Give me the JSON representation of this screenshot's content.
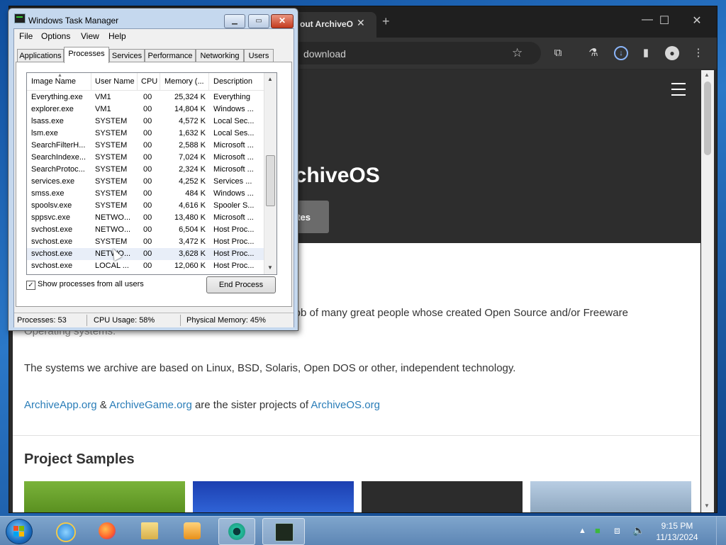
{
  "browser": {
    "tab_title": "out ArchiveO",
    "tab_close": "✕",
    "new_tab": "+",
    "url": "download",
    "minimize": "—",
    "maximize": "☐",
    "close": "✕",
    "page": {
      "hero_title": "rchiveOS",
      "hero_button": "ates",
      "intro_text": "t job of many great people whose created Open Source and/or Freeware",
      "intro_text_cont": "Operating systems.",
      "systems_text": "The systems we archive are based on Linux, BSD, Solaris, Open DOS or other, independent technology.",
      "sister_link_1": "ArchiveApp.org",
      "sister_amp": " & ",
      "sister_link_2": "ArchiveGame.org",
      "sister_mid": " are the sister projects of ",
      "sister_link_3": "ArchiveOS.org",
      "samples_title": "Project Samples"
    }
  },
  "task_manager": {
    "title": "Windows Task Manager",
    "menu": [
      "File",
      "Options",
      "View",
      "Help"
    ],
    "tabs": [
      "Applications",
      "Processes",
      "Services",
      "Performance",
      "Networking",
      "Users"
    ],
    "active_tab": "Processes",
    "columns": [
      "Image Name",
      "User Name",
      "CPU",
      "Memory (...",
      "Description"
    ],
    "processes": [
      {
        "name": "Everything.exe",
        "user": "VM1",
        "cpu": "00",
        "mem": "25,324 K",
        "desc": "Everything"
      },
      {
        "name": "explorer.exe",
        "user": "VM1",
        "cpu": "00",
        "mem": "14,804 K",
        "desc": "Windows ..."
      },
      {
        "name": "lsass.exe",
        "user": "SYSTEM",
        "cpu": "00",
        "mem": "4,572 K",
        "desc": "Local Sec..."
      },
      {
        "name": "lsm.exe",
        "user": "SYSTEM",
        "cpu": "00",
        "mem": "1,632 K",
        "desc": "Local Ses..."
      },
      {
        "name": "SearchFilterH...",
        "user": "SYSTEM",
        "cpu": "00",
        "mem": "2,588 K",
        "desc": "Microsoft ..."
      },
      {
        "name": "SearchIndexe...",
        "user": "SYSTEM",
        "cpu": "00",
        "mem": "7,024 K",
        "desc": "Microsoft ..."
      },
      {
        "name": "SearchProtoc...",
        "user": "SYSTEM",
        "cpu": "00",
        "mem": "2,324 K",
        "desc": "Microsoft ..."
      },
      {
        "name": "services.exe",
        "user": "SYSTEM",
        "cpu": "00",
        "mem": "4,252 K",
        "desc": "Services ..."
      },
      {
        "name": "smss.exe",
        "user": "SYSTEM",
        "cpu": "00",
        "mem": "484 K",
        "desc": "Windows ..."
      },
      {
        "name": "spoolsv.exe",
        "user": "SYSTEM",
        "cpu": "00",
        "mem": "4,616 K",
        "desc": "Spooler S..."
      },
      {
        "name": "sppsvc.exe",
        "user": "NETWO...",
        "cpu": "00",
        "mem": "13,480 K",
        "desc": "Microsoft ..."
      },
      {
        "name": "svchost.exe",
        "user": "NETWO...",
        "cpu": "00",
        "mem": "6,504 K",
        "desc": "Host Proc..."
      },
      {
        "name": "svchost.exe",
        "user": "SYSTEM",
        "cpu": "00",
        "mem": "3,472 K",
        "desc": "Host Proc..."
      },
      {
        "name": "svchost.exe",
        "user": "NETWO...",
        "cpu": "00",
        "mem": "3,628 K",
        "desc": "Host Proc..."
      },
      {
        "name": "svchost.exe",
        "user": "LOCAL ...",
        "cpu": "00",
        "mem": "12,060 K",
        "desc": "Host Proc..."
      }
    ],
    "show_all_users_label": "Show processes from all users",
    "show_all_users_checked": "✓",
    "end_process_label": "End Process",
    "status": {
      "processes": "Processes: 53",
      "cpu": "CPU Usage: 58%",
      "memory": "Physical Memory: 45%"
    }
  },
  "taskbar": {
    "pinned": [
      "start-button",
      "internet-explorer",
      "firefox",
      "file-explorer",
      "media-player",
      "chrome",
      "task-manager"
    ],
    "clock_time": "9:15 PM",
    "clock_date": "11/13/2024"
  },
  "colors": {
    "chrome_dark": "#2b2b2b",
    "link": "#2a7db8",
    "taskbar": "#5d86b5"
  }
}
